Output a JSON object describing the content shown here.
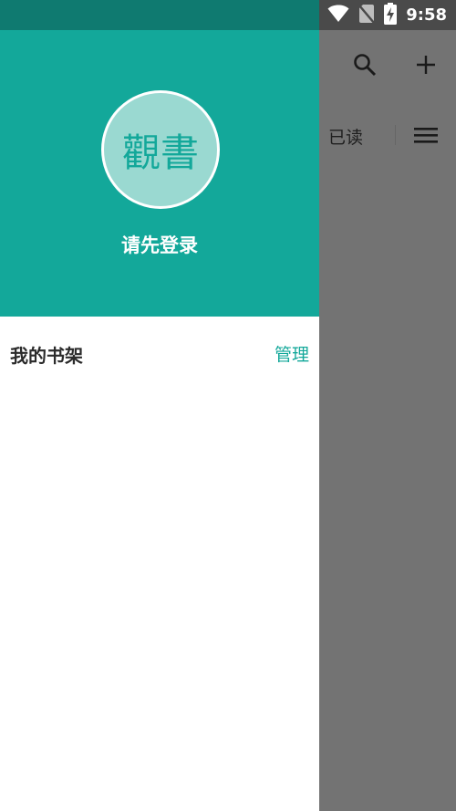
{
  "status_bar": {
    "time": "9:58",
    "icons": [
      "wifi-icon",
      "no-sim-icon",
      "battery-charging-icon"
    ]
  },
  "toolbar": {
    "search_icon": "search-icon",
    "add_icon": "add-icon",
    "menu_icon": "menu-icon"
  },
  "main": {
    "read_tab_label": "已读"
  },
  "drawer": {
    "avatar_text": "觀書",
    "login_prompt": "请先登录",
    "shelf_title": "我的书架",
    "manage_label": "管理"
  },
  "colors": {
    "accent": "#13a89a",
    "status_bar": "#0f7a70",
    "scrim": "#737373",
    "avatar_bg": "#9ad9d1"
  }
}
